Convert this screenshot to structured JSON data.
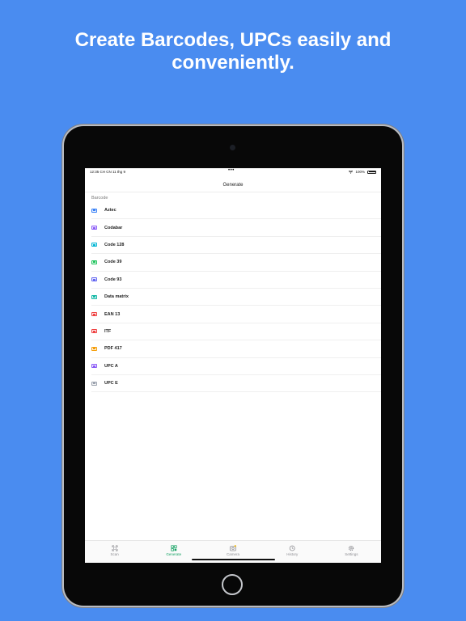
{
  "headline": {
    "line1": "Create Barcodes, UPCs easily and",
    "line2": "conveniently."
  },
  "status_bar": {
    "time_date": "12:35 CH   CN 11 thg 9",
    "dots": "•••",
    "battery_percent": "100%"
  },
  "nav": {
    "title": "Generate"
  },
  "section": {
    "header": "Barcode"
  },
  "items": [
    {
      "label": "Aztec",
      "icon": "aztec-icon",
      "color": "#3b82f6"
    },
    {
      "label": "Codabar",
      "icon": "codabar-icon",
      "color": "#8b5cf6"
    },
    {
      "label": "Code 128",
      "icon": "code128-icon",
      "color": "#06b6d4"
    },
    {
      "label": "Code 39",
      "icon": "code39-icon",
      "color": "#22c55e"
    },
    {
      "label": "Code 93",
      "icon": "code93-icon",
      "color": "#6366f1"
    },
    {
      "label": "Data matrix",
      "icon": "datamatrix-icon",
      "color": "#14b8a6"
    },
    {
      "label": "EAN 13",
      "icon": "ean13-icon",
      "color": "#ef4444"
    },
    {
      "label": "ITF",
      "icon": "itf-icon",
      "color": "#ef4444"
    },
    {
      "label": "PDF 417",
      "icon": "pdf417-icon",
      "color": "#f59e0b"
    },
    {
      "label": "UPC A",
      "icon": "upca-icon",
      "color": "#8b5cf6"
    },
    {
      "label": "UPC E",
      "icon": "upce-icon",
      "color": "#9ca3af"
    }
  ],
  "tabs": [
    {
      "label": "Scan",
      "icon": "scan-icon",
      "active": false
    },
    {
      "label": "Generate",
      "icon": "generate-icon",
      "active": true
    },
    {
      "label": "Camera",
      "icon": "camera-icon",
      "active": false
    },
    {
      "label": "History",
      "icon": "history-icon",
      "active": false
    },
    {
      "label": "Settings",
      "icon": "settings-icon",
      "active": false
    }
  ],
  "colors": {
    "background": "#4a8cf0",
    "accent": "#17a365",
    "inactive_tab": "#8e8e93"
  }
}
